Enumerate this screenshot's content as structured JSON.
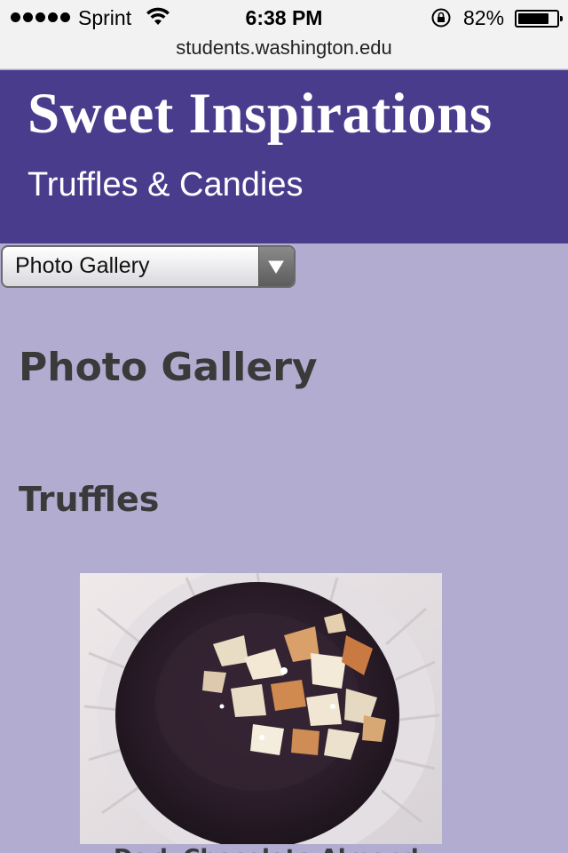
{
  "status_bar": {
    "carrier": "Sprint",
    "time": "6:38 PM",
    "battery_percent": "82%",
    "battery_level": 0.82,
    "icons": [
      "signal-dots-icon",
      "wifi-icon",
      "rotation-lock-icon",
      "battery-icon"
    ]
  },
  "browser": {
    "url": "students.washington.edu"
  },
  "header": {
    "title": "Sweet Inspirations",
    "subtitle": "Truffles & Candies",
    "background_color": "#493c8d"
  },
  "nav": {
    "selected": "Photo Gallery"
  },
  "main": {
    "page_title": "Photo Gallery",
    "section_title": "Truffles",
    "photo": {
      "alt": "",
      "caption": "Dark Chocolate Almond"
    },
    "background_color": "#b1acd0"
  }
}
